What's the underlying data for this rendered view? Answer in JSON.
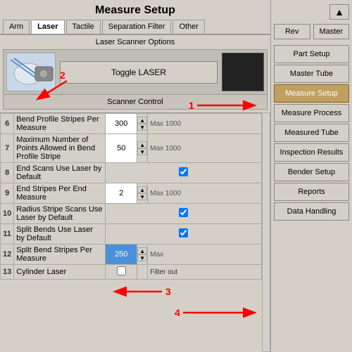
{
  "title": "Measure Setup",
  "tabs": [
    {
      "label": "Arm",
      "active": false
    },
    {
      "label": "Laser",
      "active": true
    },
    {
      "label": "Tactile",
      "active": false
    },
    {
      "label": "Separation Filter",
      "active": false
    },
    {
      "label": "Other",
      "active": false
    }
  ],
  "scanner": {
    "section_label": "Laser Scanner Options",
    "toggle_button": "Toggle LASER",
    "control_label": "Scanner Control"
  },
  "table_rows": [
    {
      "num": "6",
      "label": "Bend Profile Stripes Per Measure",
      "value": "300",
      "max": "Max 1000",
      "type": "spinner"
    },
    {
      "num": "7",
      "label": "Maximum Number of Points Allowed in Bend Profile Stripe",
      "value": "50",
      "max": "Max 1000",
      "type": "spinner"
    },
    {
      "num": "8",
      "label": "End Scans Use Laser by Default",
      "value": "",
      "max": "",
      "type": "checkbox",
      "checked": true
    },
    {
      "num": "9",
      "label": "End Stripes Per End Measure",
      "value": "2",
      "max": "Max 1000",
      "type": "spinner"
    },
    {
      "num": "10",
      "label": "Radius Stripe Scans Use Laser by Default",
      "value": "",
      "max": "",
      "type": "checkbox",
      "checked": true
    },
    {
      "num": "11",
      "label": "Split Bends Use Laser by Default",
      "value": "",
      "max": "",
      "type": "checkbox",
      "checked": true
    },
    {
      "num": "12",
      "label": "Split Bend Stripes Per Measure",
      "value": "250",
      "max": "Max",
      "type": "spinner_blue"
    },
    {
      "num": "13",
      "label": "Cylinder Laser",
      "value": "",
      "max": "Filter out",
      "type": "checkbox"
    }
  ],
  "annotations": [
    {
      "label": "1"
    },
    {
      "label": "2"
    },
    {
      "label": "3"
    },
    {
      "label": "4"
    }
  ],
  "right_panel": {
    "rev_button": "Rev",
    "master_button": "Master",
    "nav_items": [
      {
        "label": "Part Setup",
        "active": false
      },
      {
        "label": "Master Tube",
        "active": false
      },
      {
        "label": "Measure Setup",
        "active": true
      },
      {
        "label": "Measure Process",
        "active": false
      },
      {
        "label": "Measured Tube",
        "active": false
      },
      {
        "label": "Inspection Results",
        "active": false
      },
      {
        "label": "Bender Setup",
        "active": false
      },
      {
        "label": "Reports",
        "active": false
      },
      {
        "label": "Data Handling",
        "active": false
      }
    ]
  }
}
